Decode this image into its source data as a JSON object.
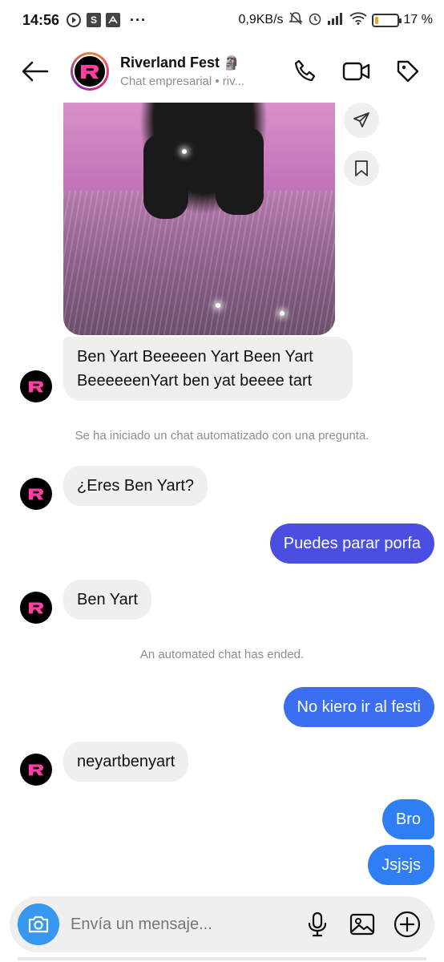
{
  "status": {
    "time": "14:56",
    "speed": "0,9KB/s",
    "battery_percent": "17 %",
    "battery_level": 0.17,
    "app_badge": "S"
  },
  "header": {
    "title": "Riverland Fest",
    "title_emoji": "🗿",
    "subtitle": "Chat empresarial • riv..."
  },
  "messages": {
    "bubble1": "Ben Yart Beeeeen Yart Been Yart BeeeeeenYart ben yat beeee tart",
    "system1": "Se ha iniciado un chat automatizado con una pregunta.",
    "bubble2": "¿Eres Ben Yart?",
    "out1": "Puedes parar porfa",
    "bubble3": "Ben Yart",
    "system2": "An automated chat has ended.",
    "out2": "No kiero ir al festi",
    "bubble4": "neyartbenyart",
    "out3": "Bro",
    "out4": "Jsjsjs"
  },
  "composer": {
    "placeholder": "Envía un mensaje..."
  },
  "colors": {
    "accent_purple": "#4b4fe0",
    "accent_blue": "#3797f0",
    "brand_pink": "#ff3fa4"
  }
}
